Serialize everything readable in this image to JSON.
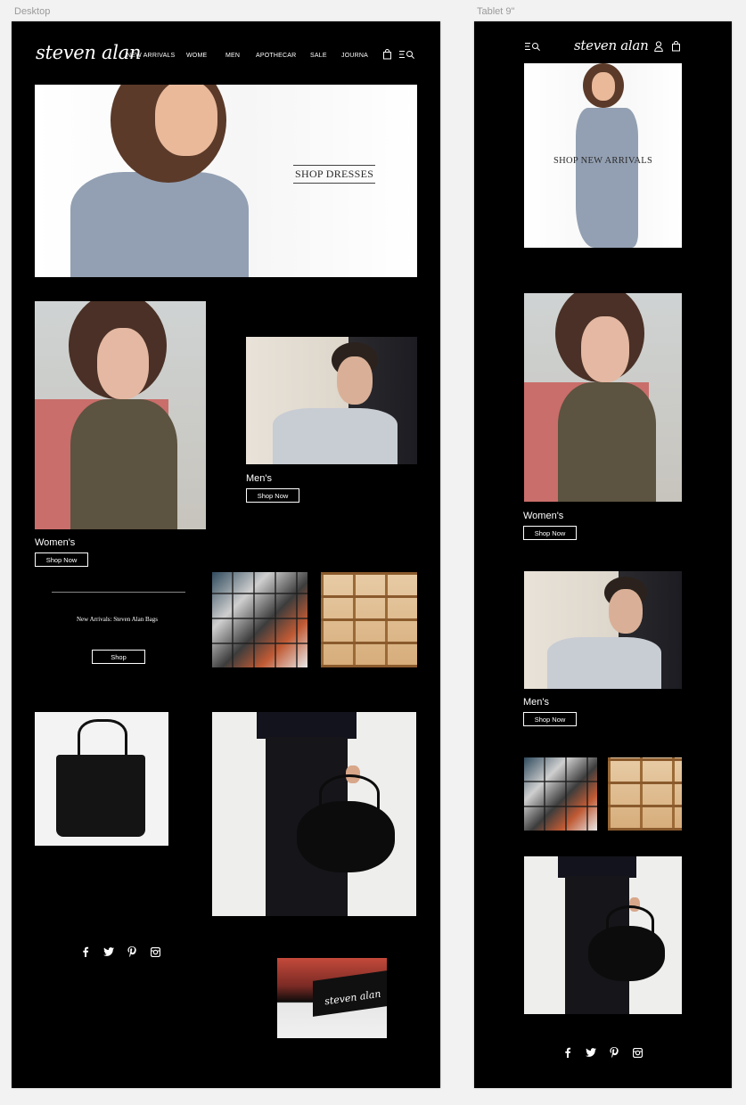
{
  "frames": {
    "desktop_label": "Desktop",
    "tablet_label": "Tablet 9\""
  },
  "brand": {
    "logo_text": "steven alan"
  },
  "desktop": {
    "nav": {
      "items": [
        "NEW ARRIVALS",
        "WOME",
        "MEN",
        "APOTHECAR",
        "SALE",
        "JOURNA"
      ]
    },
    "hero": {
      "cta_label": "SHOP DRESSES"
    },
    "womens": {
      "label": "Women's",
      "button": "Shop Now"
    },
    "mens": {
      "label": "Men's",
      "button": "Shop Now"
    },
    "promo": {
      "text": "New Arrivals: Steven Alan Bags",
      "button": "Shop"
    },
    "social": [
      "facebook-icon",
      "twitter-icon",
      "pinterest-icon",
      "instagram-icon"
    ]
  },
  "tablet": {
    "hero": {
      "cta_label": "SHOP NEW ARRIVALS"
    },
    "womens": {
      "label": "Women's",
      "button": "Shop Now"
    },
    "mens": {
      "label": "Men's",
      "button": "Shop Now"
    },
    "social": [
      "facebook-icon",
      "twitter-icon",
      "pinterest-icon",
      "instagram-icon"
    ]
  },
  "colors": {
    "canvas": "#f2f2f2",
    "artboard": "#000000",
    "text_on_dark": "#ffffff",
    "frame_label": "#9a9a9a"
  }
}
